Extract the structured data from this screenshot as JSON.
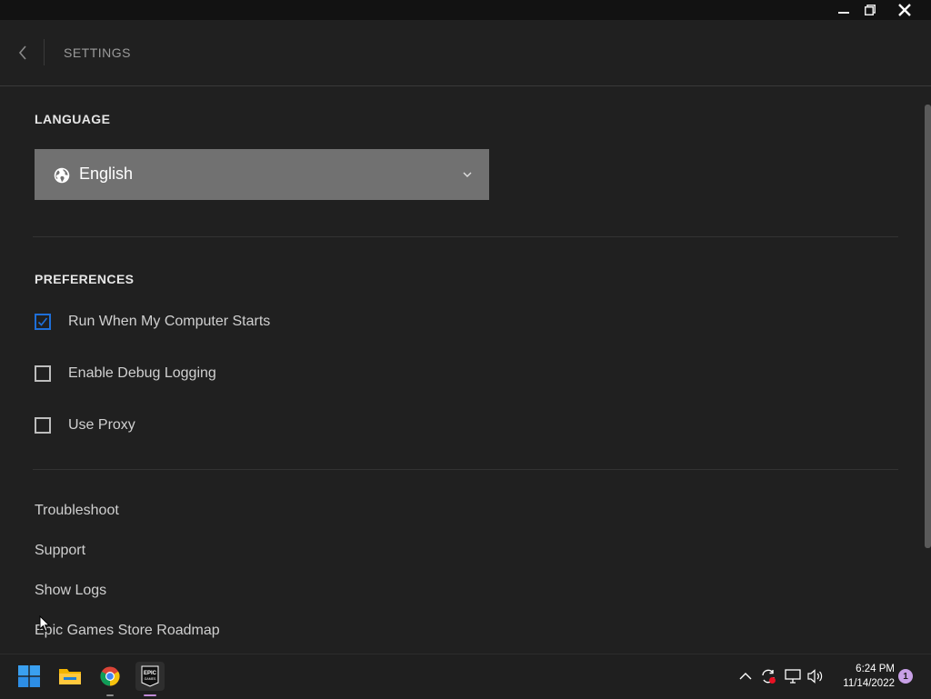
{
  "window": {
    "buttons": {
      "minimize_icon": "minimize-icon",
      "restore_icon": "restore-icon",
      "close_icon": "close-icon"
    }
  },
  "header": {
    "title": "SETTINGS",
    "back_icon": "chevron-left-icon"
  },
  "language": {
    "section_title": "LANGUAGE",
    "selected": "English",
    "icon": "globe-icon",
    "dropdown_icon": "chevron-down-icon"
  },
  "preferences": {
    "section_title": "PREFERENCES",
    "items": [
      {
        "label": "Run When My Computer Starts",
        "checked": true
      },
      {
        "label": "Enable Debug Logging",
        "checked": false
      },
      {
        "label": "Use Proxy",
        "checked": false
      }
    ]
  },
  "links": [
    "Troubleshoot",
    "Support",
    "Show Logs",
    "Epic Games Store Roadmap"
  ],
  "taskbar": {
    "apps": [
      "windows-start-icon",
      "file-explorer-icon",
      "chrome-icon",
      "epic-games-icon"
    ],
    "epic_label_top": "EPIC",
    "epic_label_bottom": "GAMES",
    "tray": [
      "chevron-up-icon",
      "sync-icon",
      "network-icon",
      "volume-icon"
    ],
    "time": "6:24 PM",
    "date": "11/14/2022",
    "notification_count": "1"
  },
  "colors": {
    "accent": "#1e6fd9",
    "background": "#202020",
    "dropdown": "#717171",
    "badge": "#c8a0e6"
  }
}
